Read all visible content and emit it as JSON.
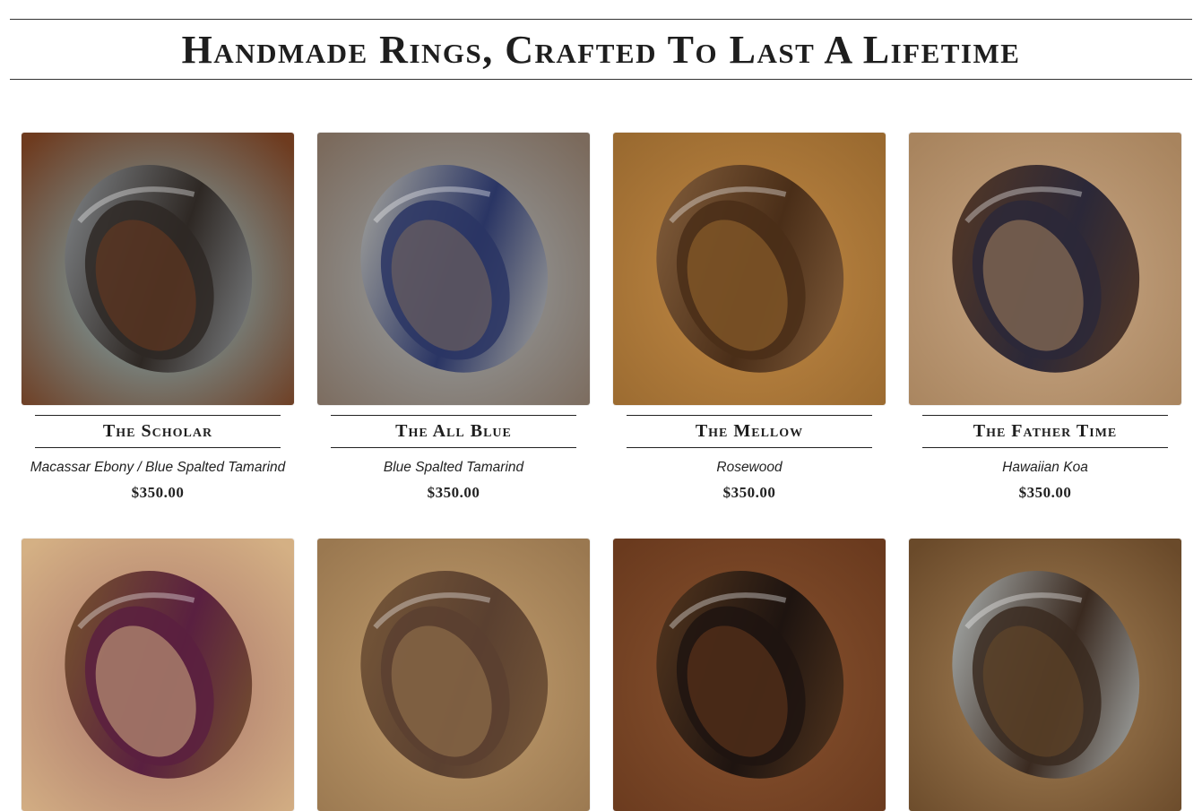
{
  "header": {
    "title": "Handmade Rings, Crafted To Last A Lifetime"
  },
  "products": [
    {
      "name": "The Scholar",
      "material": "Macassar Ebony / Blue Spalted Tamarind",
      "price": "$350.00",
      "bg": "#7fb3bf",
      "bg2": "#6e3b1f",
      "ring": "#2e2824",
      "ring2": "#8a8f93"
    },
    {
      "name": "The All Blue",
      "material": "Blue Spalted Tamarind",
      "price": "$350.00",
      "bg": "#9aa3a8",
      "bg2": "#7b6a5c",
      "ring": "#2a3564",
      "ring2": "#b4b2a4"
    },
    {
      "name": "The Mellow",
      "material": "Rosewood",
      "price": "$350.00",
      "bg": "#c28a45",
      "bg2": "#9a6a30",
      "ring": "#4a2e18",
      "ring2": "#8a6440"
    },
    {
      "name": "The Father Time",
      "material": "Hawaiian Koa",
      "price": "$350.00",
      "bg": "#c9a886",
      "bg2": "#a8845e",
      "ring": "#2b2838",
      "ring2": "#5a3a22"
    },
    {
      "name": "",
      "material": "",
      "price": "",
      "bg": "#a8726a",
      "bg2": "#d4b084",
      "ring": "#5a2040",
      "ring2": "#7a5a2a"
    },
    {
      "name": "",
      "material": "",
      "price": "",
      "bg": "#c4a070",
      "bg2": "#9a7850",
      "ring": "#5a4030",
      "ring2": "#7a5a3a"
    },
    {
      "name": "",
      "material": "",
      "price": "",
      "bg": "#8a5430",
      "bg2": "#6a3a1e",
      "ring": "#1e1410",
      "ring2": "#5a3a20"
    },
    {
      "name": "",
      "material": "",
      "price": "",
      "bg": "#a88458",
      "bg2": "#6a4a2a",
      "ring": "#3a2a20",
      "ring2": "#b8c0c0"
    }
  ]
}
